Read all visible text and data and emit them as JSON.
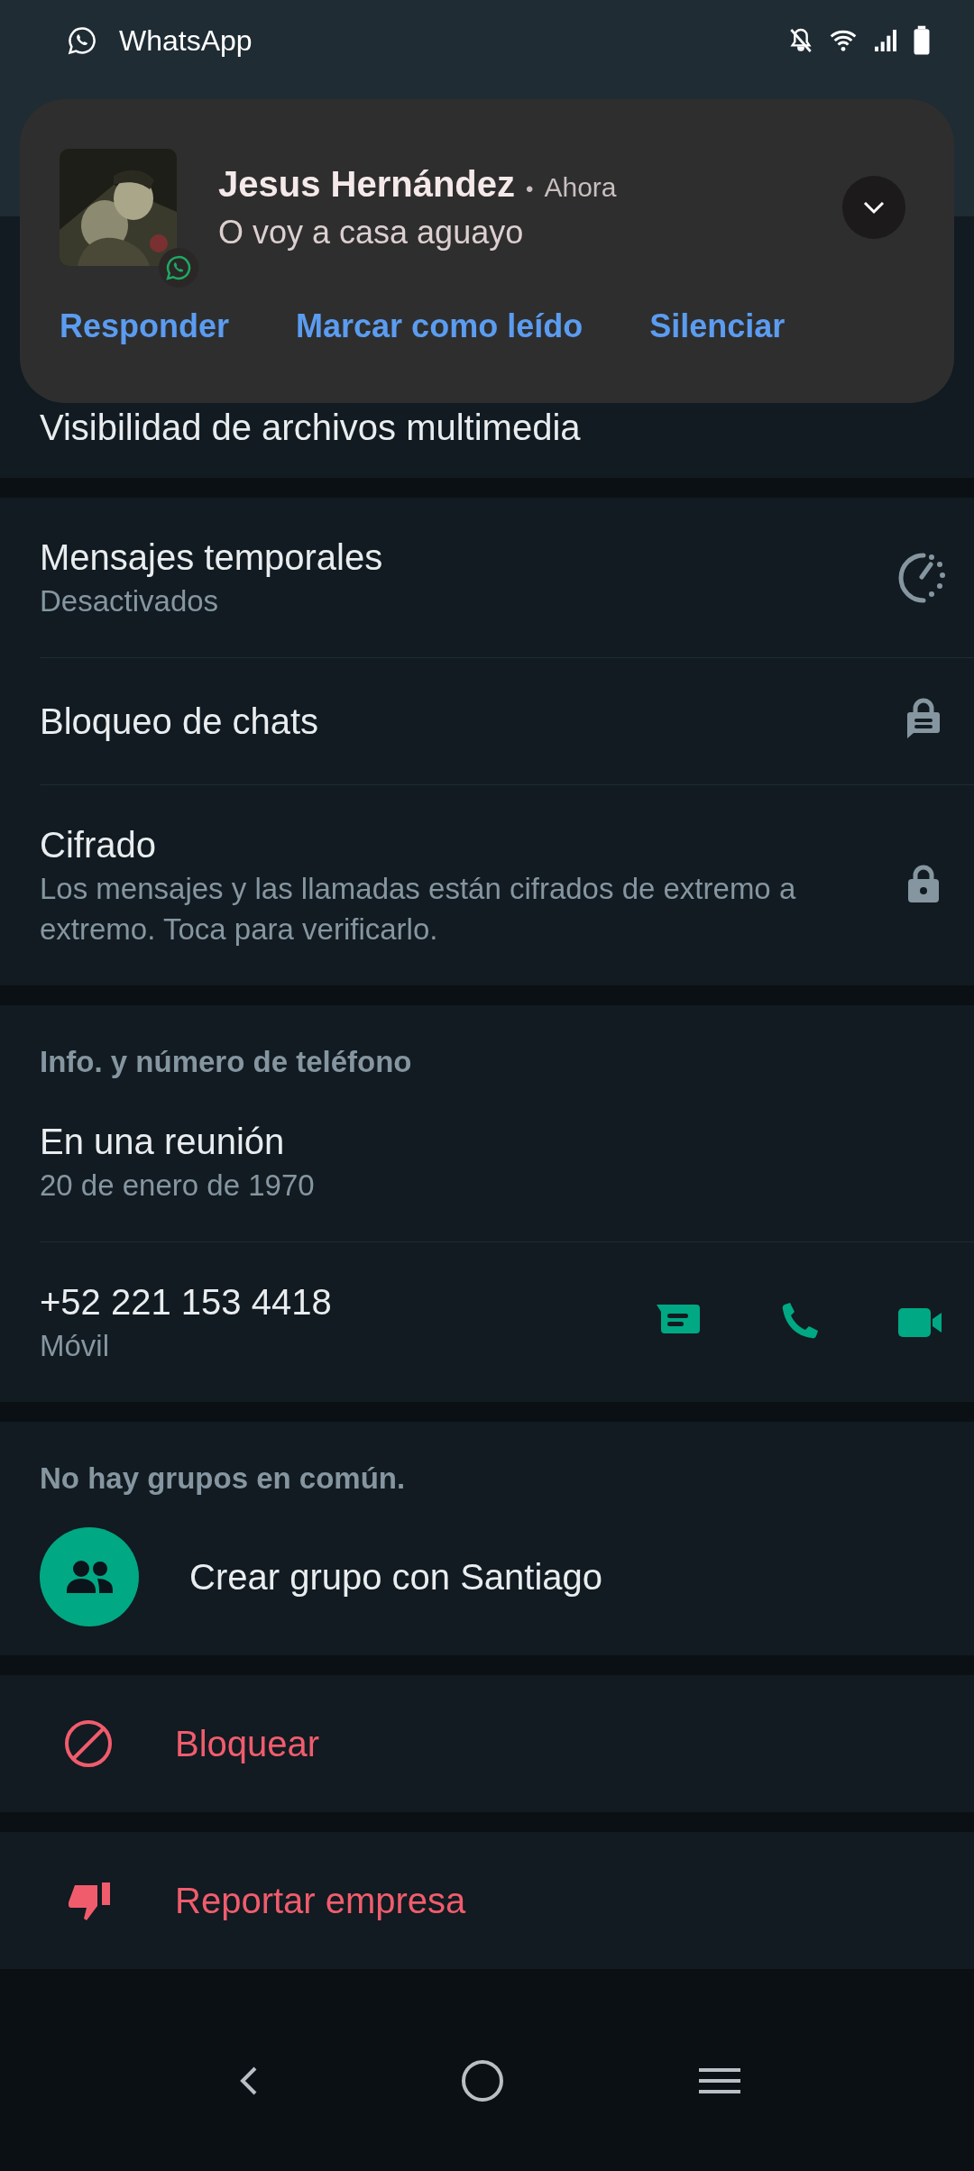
{
  "status_bar": {
    "app": "WhatsApp"
  },
  "notification": {
    "sender": "Jesus Hernández",
    "separator": "•",
    "time": "Ahora",
    "message": "O voy a casa aguayo",
    "actions": [
      "Responder",
      "Marcar como leído",
      "Silenciar"
    ]
  },
  "sections": [
    {
      "rows": [
        {
          "kind": "plain",
          "title": "Visibilidad de archivos multimedia"
        }
      ]
    },
    {
      "rows": [
        {
          "kind": "timer",
          "title": "Mensajes temporales",
          "subtitle": "Desactivados"
        },
        {
          "kind": "chatlock",
          "title": "Bloqueo de chats"
        },
        {
          "kind": "lock",
          "title": "Cifrado",
          "subtitle": "Los mensajes y las llamadas están cifrados de extremo a extremo. Toca para verificarlo."
        }
      ]
    },
    {
      "header": "Info. y número de teléfono",
      "rows": [
        {
          "kind": "about",
          "title": "En una reunión",
          "subtitle": "20 de enero de 1970"
        },
        {
          "kind": "phone",
          "title": "+52 221 153 4418",
          "subtitle": "Móvil"
        }
      ]
    },
    {
      "header": "No hay grupos en común.",
      "rows": [
        {
          "kind": "group",
          "title": "Crear grupo con Santiago"
        }
      ]
    },
    {
      "rows": [
        {
          "kind": "block",
          "title": "Bloquear"
        }
      ]
    },
    {
      "rows": [
        {
          "kind": "report",
          "title": "Reportar empresa"
        }
      ]
    }
  ]
}
